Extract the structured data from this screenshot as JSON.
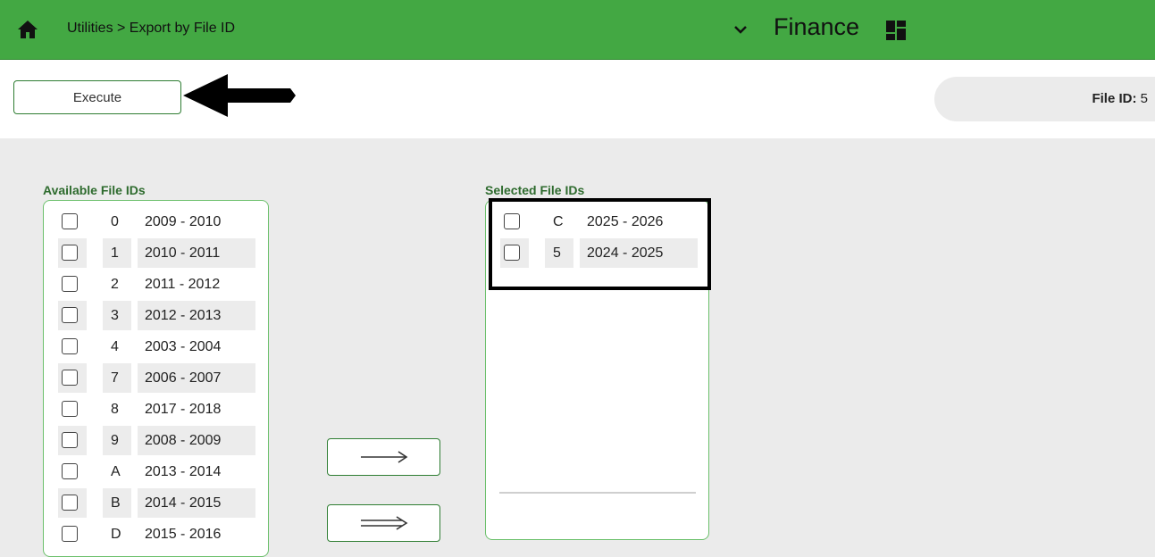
{
  "header": {
    "breadcrumb": "Utilities > Export by File ID",
    "app_title": "Finance",
    "home_icon": "home-icon",
    "menu_icon": "chevron-down-icon",
    "grid_icon": "dashboard-grid-icon"
  },
  "toolbar": {
    "execute_label": "Execute",
    "file_id_label": "File ID:",
    "file_id_value": "5"
  },
  "available": {
    "label": "Available File IDs",
    "items": [
      {
        "code": "0",
        "years": "2009 - 2010"
      },
      {
        "code": "1",
        "years": "2010 - 2011"
      },
      {
        "code": "2",
        "years": "2011 - 2012"
      },
      {
        "code": "3",
        "years": "2012 - 2013"
      },
      {
        "code": "4",
        "years": "2003 - 2004"
      },
      {
        "code": "7",
        "years": "2006 - 2007"
      },
      {
        "code": "8",
        "years": "2017 - 2018"
      },
      {
        "code": "9",
        "years": "2008 - 2009"
      },
      {
        "code": "A",
        "years": "2013 - 2014"
      },
      {
        "code": "B",
        "years": "2014 - 2015"
      },
      {
        "code": "D",
        "years": "2015 - 2016"
      }
    ]
  },
  "selected": {
    "label": "Selected File IDs",
    "items": [
      {
        "code": "C",
        "years": "2025 - 2026"
      },
      {
        "code": "5",
        "years": "2024 - 2025"
      }
    ]
  },
  "buttons": {
    "move_selected_icon": "arrow-right-icon",
    "move_all_icon": "double-arrow-right-icon"
  },
  "colors": {
    "header_bg": "#43a843",
    "accent_green": "#2e7d32",
    "list_border": "#6cc06c"
  }
}
